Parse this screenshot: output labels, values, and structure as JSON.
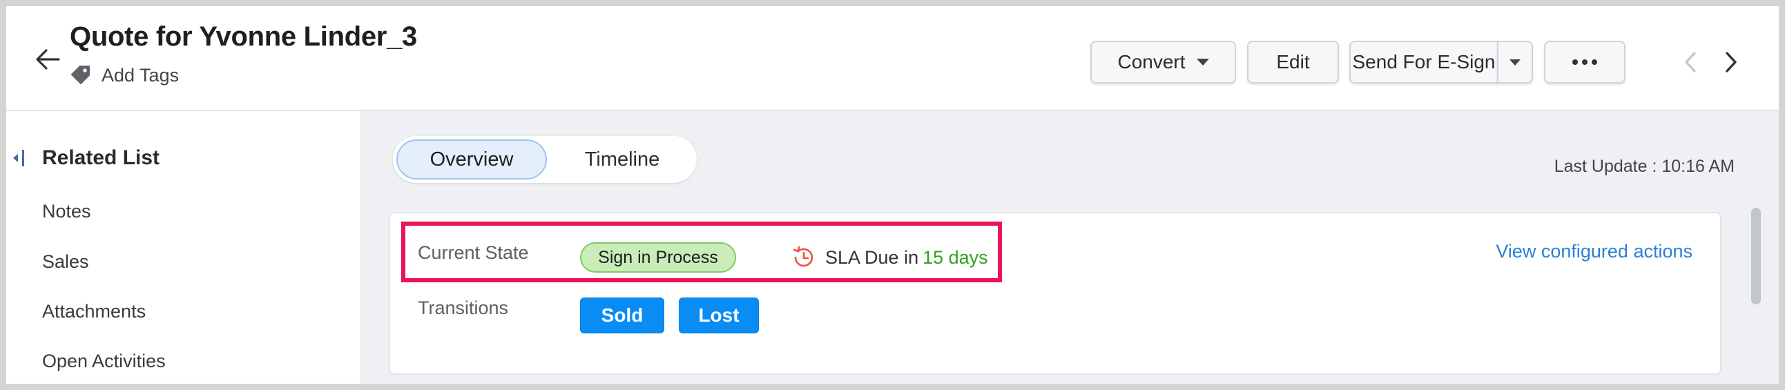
{
  "header": {
    "title": "Quote for Yvonne Linder_3",
    "add_tags_label": "Add Tags",
    "buttons": {
      "convert": "Convert",
      "edit": "Edit",
      "send_for_esign": "Send For E-Sign"
    }
  },
  "sidebar": {
    "heading": "Related List",
    "items": [
      {
        "label": "Notes"
      },
      {
        "label": "Sales"
      },
      {
        "label": "Attachments"
      },
      {
        "label": "Open Activities"
      }
    ]
  },
  "main": {
    "tabs": [
      {
        "label": "Overview",
        "selected": true
      },
      {
        "label": "Timeline",
        "selected": false
      }
    ],
    "last_update": "Last Update : 10:16 AM",
    "blueprint": {
      "current_state_label": "Current State",
      "current_state_value": "Sign in Process",
      "sla_prefix": "SLA Due in",
      "sla_days": "15 days",
      "view_actions_label": "View configured actions",
      "transitions_label": "Transitions",
      "transitions": [
        "Sold",
        "Lost"
      ]
    }
  },
  "colors": {
    "accent_blue": "#0a8cf5",
    "link_blue": "#2b7fd4",
    "sla_green": "#2fa31f",
    "status_green_bg": "#c9ecb9",
    "highlight_red": "#e91557",
    "clock_red": "#e8523f"
  },
  "icons": {
    "back": "arrow-left-icon",
    "tag": "tag-icon",
    "prev": "chevron-left-icon",
    "next": "chevron-right-icon",
    "more": "more-dots-icon",
    "collapse": "collapse-sidebar-icon",
    "sla": "clock-history-icon"
  }
}
